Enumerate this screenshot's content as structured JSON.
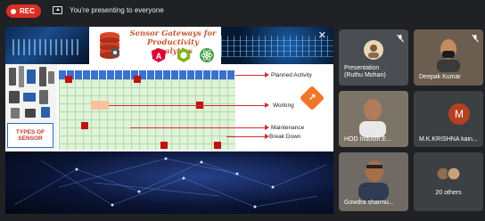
{
  "topbar": {
    "rec_label": "REC",
    "presenting_text": "You're presenting to everyone"
  },
  "slide": {
    "title": "Sensor Gateways for Productivity Analytics",
    "sensor_label_line1": "TYPES OF",
    "sensor_label_line2": "SENSOR",
    "labels": {
      "planned": "Planned Activity",
      "working": "Working",
      "maintenance": "Maintenance",
      "breakdown": "Break Down"
    }
  },
  "participants": [
    {
      "name_line1": "Presentation",
      "name_line2": "(Ruthu Mohan)"
    },
    {
      "name": "Deepak Kumar"
    },
    {
      "name": "HOD Industri.E..."
    },
    {
      "name": "M.K.KRISHNA kain...",
      "initial": "M"
    },
    {
      "name": "Gowdra sharmu..."
    },
    {
      "name": "20 others"
    }
  ],
  "colors": {
    "rec": "#d93025",
    "avatar_m": "#b5401f",
    "tile_bg": "#3c4043",
    "app_bg": "#202124"
  }
}
